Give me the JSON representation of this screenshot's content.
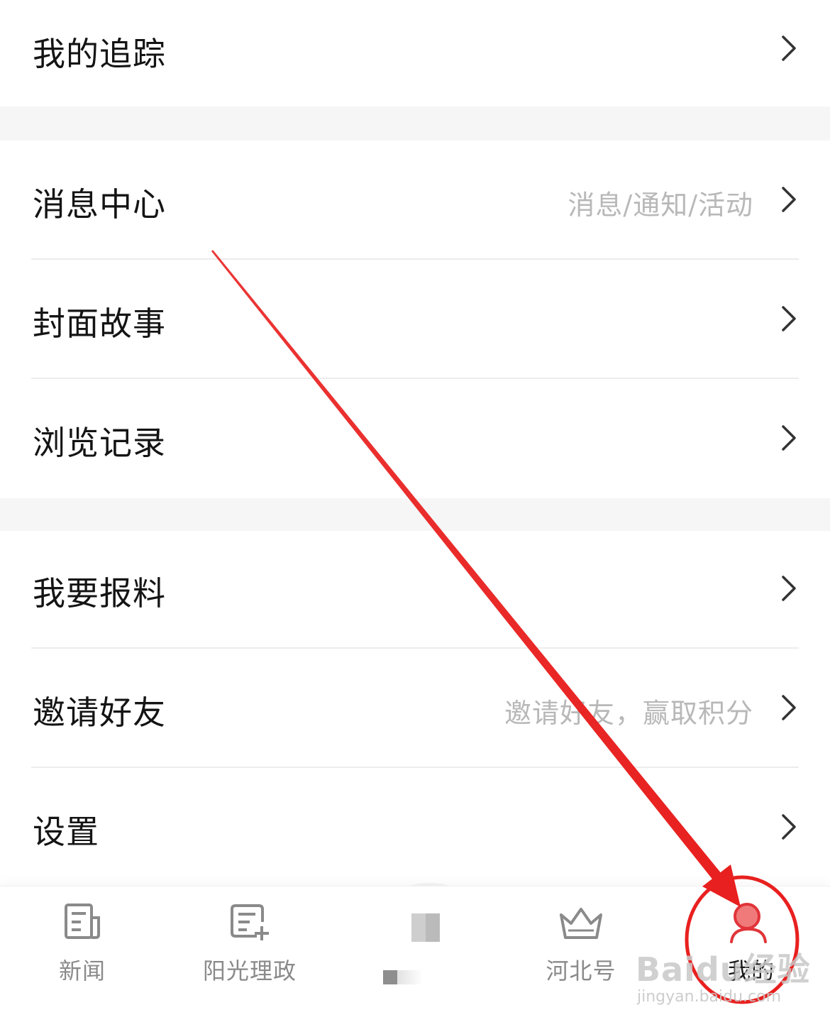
{
  "menu": {
    "my_tracking": {
      "label": "我的追踪"
    },
    "message_center": {
      "label": "消息中心",
      "hint": "消息/通知/活动"
    },
    "cover_story": {
      "label": "封面故事"
    },
    "browse_history": {
      "label": "浏览记录"
    },
    "report_news": {
      "label": "我要报料"
    },
    "invite_friends": {
      "label": "邀请好友",
      "hint": "邀请好友，赢取积分"
    },
    "settings": {
      "label": "设置"
    }
  },
  "tabbar": {
    "news": {
      "label": "新闻",
      "icon": "newspaper-icon"
    },
    "sunshine": {
      "label": "阳光理政",
      "icon": "edit-doc-icon"
    },
    "center": {
      "label": "",
      "icon": "center-placeholder-icon"
    },
    "hebei": {
      "label": "河北号",
      "icon": "crown-icon"
    },
    "mine": {
      "label": "我的",
      "icon": "user-icon",
      "active": true
    }
  },
  "annotation": {
    "color": "#e8201f"
  },
  "watermark": {
    "text": "Baidu经验",
    "sub": "jingyan.baidu.com"
  }
}
